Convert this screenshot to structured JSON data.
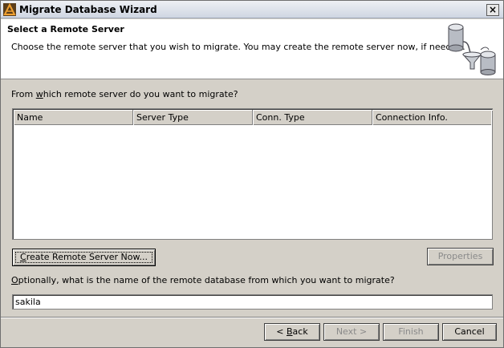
{
  "window": {
    "title": "Migrate Database Wizard",
    "close_glyph": "×"
  },
  "header": {
    "title": "Select a Remote Server",
    "description": "Choose the remote server that you wish to migrate. You may create the remote server now, if needed.",
    "icon": "database-migrate-icon"
  },
  "server_section": {
    "question_prefix": "From ",
    "question_mnemonic": "w",
    "question_suffix": "hich remote server do you want to migrate?",
    "columns": [
      "Name",
      "Server Type",
      "Conn. Type",
      "Connection Info."
    ],
    "rows": []
  },
  "buttons": {
    "create_mnemonic": "C",
    "create_rest": "reate Remote Server Now...",
    "properties": "Properties",
    "back_prefix": "< ",
    "back_mnemonic": "B",
    "back_rest": "ack",
    "next": "Next >",
    "finish": "Finish",
    "cancel": "Cancel"
  },
  "database_section": {
    "label_mnemonic": "O",
    "label_rest": "ptionally, what is the name of the remote database from which you want to migrate?",
    "value": "sakila"
  },
  "colors": {
    "dialog_bg": "#d4d0c8",
    "disabled_text": "#8a8a8a"
  }
}
